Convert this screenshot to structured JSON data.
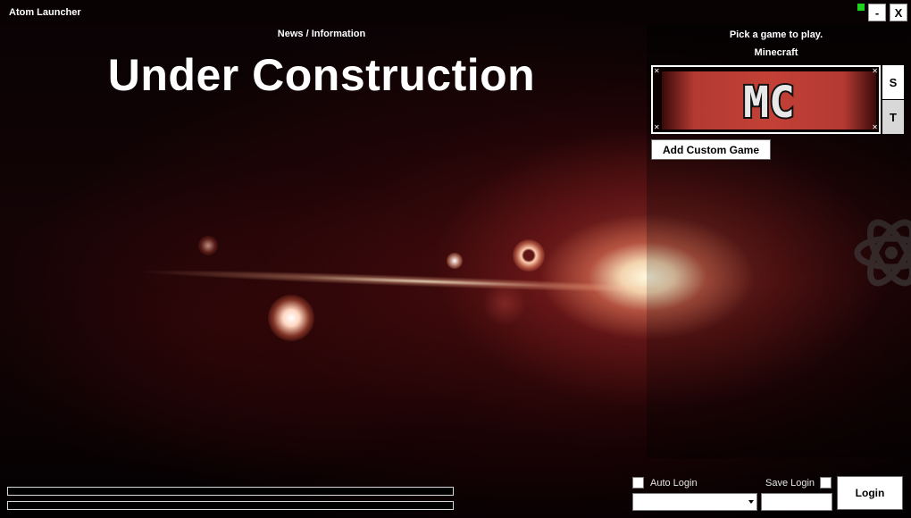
{
  "window": {
    "title": "Atom Launcher",
    "minimize_label": "-",
    "close_label": "X",
    "status_color": "#1fd31f"
  },
  "news": {
    "header": "News / Information",
    "headline": "Under Construction"
  },
  "games": {
    "prompt": "Pick a game to play.",
    "selected_name": "Minecraft",
    "tile_logo_text": "MC",
    "side_buttons": [
      "S",
      "T"
    ],
    "add_custom_label": "Add Custom Game"
  },
  "progress": {
    "bar1_fraction": 0,
    "bar2_fraction": 0
  },
  "login": {
    "auto_login_label": "Auto Login",
    "auto_login_checked": false,
    "save_login_label": "Save Login",
    "save_login_checked": false,
    "account_value": "",
    "password_value": "",
    "login_label": "Login"
  }
}
